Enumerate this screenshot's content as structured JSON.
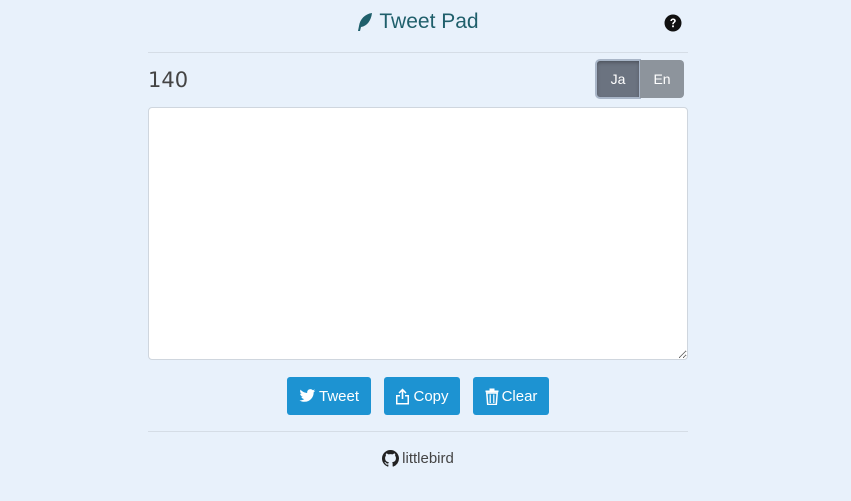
{
  "header": {
    "title": "Tweet Pad",
    "logo_icon": "feather-icon",
    "help_icon": "question-circle-icon"
  },
  "counter": {
    "remaining": "140"
  },
  "language": {
    "options": [
      {
        "label": "Ja",
        "active": true
      },
      {
        "label": "En",
        "active": false
      }
    ]
  },
  "editor": {
    "value": "",
    "placeholder": ""
  },
  "actions": {
    "tweet_label": "Tweet",
    "copy_label": "Copy",
    "clear_label": "Clear",
    "tweet_icon": "twitter-bird-icon",
    "copy_icon": "share-upload-icon",
    "clear_icon": "trash-icon"
  },
  "footer": {
    "link_label": "littlebird",
    "link_icon": "github-icon"
  },
  "colors": {
    "background": "#e8f1fb",
    "title": "#1f5f6b",
    "primary_button": "#1d93d2",
    "lang_active": "#6b7380",
    "lang_inactive": "#8d949c"
  }
}
